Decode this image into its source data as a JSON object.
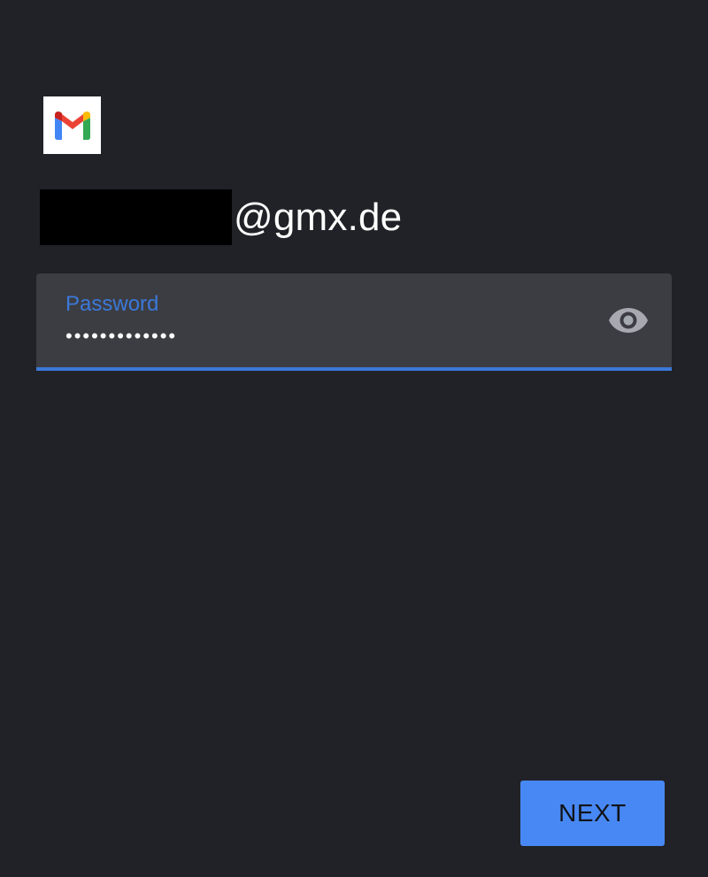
{
  "account": {
    "email_domain": "@gmx.de"
  },
  "password_field": {
    "label": "Password",
    "masked_value": "•••••••••••••",
    "accent_color": "#3b78d8"
  },
  "actions": {
    "next_label": "NEXT",
    "next_color": "#4888f4"
  },
  "icons": {
    "logo": "gmail-icon",
    "visibility": "eye-icon"
  }
}
